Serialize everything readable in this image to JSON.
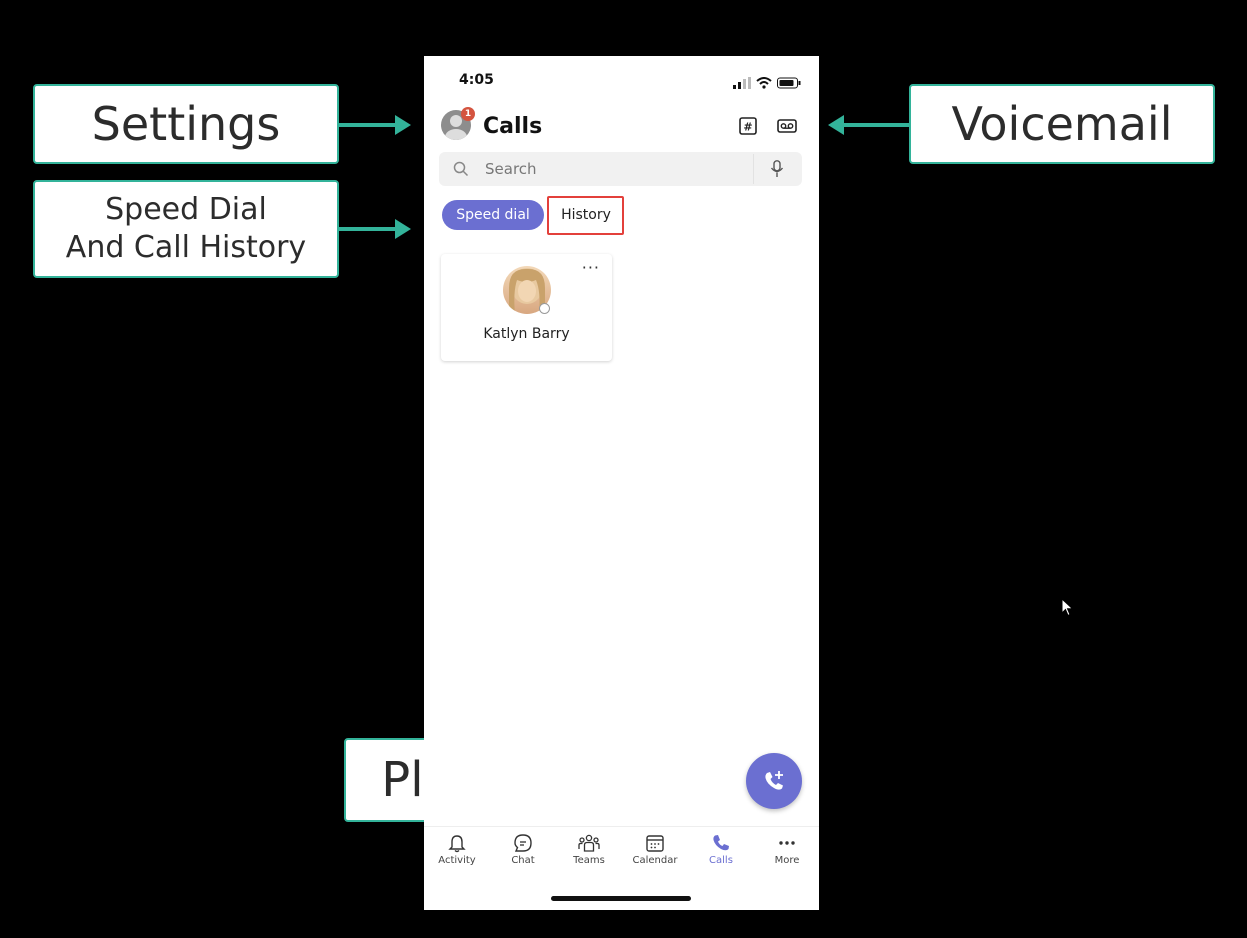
{
  "callouts": {
    "settings": "Settings",
    "speed_dial_line1": "Speed Dial",
    "speed_dial_line2": "And Call History",
    "voicemail": "Voicemail",
    "place_call": "Place Call"
  },
  "colors": {
    "callout_border": "#33b39a",
    "accent": "#6b6fd1",
    "highlight": "#e3403b",
    "badge": "#d4543f"
  },
  "status_bar": {
    "time": "4:05"
  },
  "header": {
    "title": "Calls",
    "notification_count": "1",
    "icons": [
      "dialpad-icon",
      "voicemail-icon"
    ]
  },
  "search": {
    "placeholder": "Search"
  },
  "tabs": {
    "speed_dial": "Speed dial",
    "history": "History",
    "selected": "Speed dial"
  },
  "speed_dial_contacts": [
    {
      "name": "Katlyn Barry",
      "more": "···"
    }
  ],
  "bottom_nav": [
    {
      "label": "Activity",
      "icon": "bell-icon"
    },
    {
      "label": "Chat",
      "icon": "chat-icon"
    },
    {
      "label": "Teams",
      "icon": "teams-icon"
    },
    {
      "label": "Calendar",
      "icon": "calendar-icon"
    },
    {
      "label": "Calls",
      "icon": "phone-icon",
      "active": true
    },
    {
      "label": "More",
      "icon": "more-icon"
    }
  ]
}
